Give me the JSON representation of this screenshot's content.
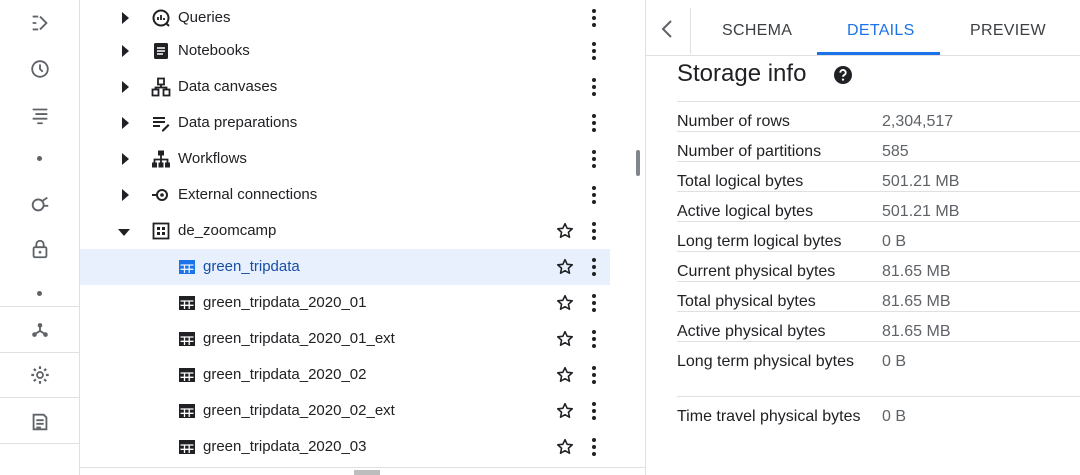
{
  "rail": {
    "icons": [
      "transfer-icon",
      "history-icon",
      "list-icon",
      "analytics-icon",
      "lock-icon",
      "hub-icon",
      "settings-icon",
      "notes-icon"
    ]
  },
  "explorer": {
    "rows": [
      {
        "label": "Queries",
        "icon": "queries-icon",
        "expander": "collapsed",
        "star": false
      },
      {
        "label": "Notebooks",
        "icon": "notebook-icon",
        "expander": "collapsed",
        "star": false
      },
      {
        "label": "Data canvases",
        "icon": "canvas-icon",
        "expander": "collapsed",
        "star": false
      },
      {
        "label": "Data preparations",
        "icon": "data-prep-icon",
        "expander": "collapsed",
        "star": false
      },
      {
        "label": "Workflows",
        "icon": "workflow-icon",
        "expander": "collapsed",
        "star": false
      },
      {
        "label": "External connections",
        "icon": "connection-icon",
        "expander": "collapsed",
        "star": false
      },
      {
        "label": "de_zoomcamp",
        "icon": "dataset-icon",
        "expander": "expanded",
        "star": true
      },
      {
        "label": "green_tripdata",
        "icon": "table-icon",
        "expander": "none",
        "star": true,
        "selected": true
      },
      {
        "label": "green_tripdata_2020_01",
        "icon": "table-icon",
        "expander": "none",
        "star": true
      },
      {
        "label": "green_tripdata_2020_01_ext",
        "icon": "table-icon",
        "expander": "none",
        "star": true
      },
      {
        "label": "green_tripdata_2020_02",
        "icon": "table-icon",
        "expander": "none",
        "star": true
      },
      {
        "label": "green_tripdata_2020_02_ext",
        "icon": "table-icon",
        "expander": "none",
        "star": true
      },
      {
        "label": "green_tripdata_2020_03",
        "icon": "table-icon",
        "expander": "none",
        "star": true
      }
    ]
  },
  "panel": {
    "tabs": [
      {
        "label": "SCHEMA",
        "active": false
      },
      {
        "label": "DETAILS",
        "active": true
      },
      {
        "label": "PREVIEW",
        "active": false
      }
    ],
    "title": "Storage info",
    "rows": [
      {
        "key": "Number of rows",
        "value": "2,304,517"
      },
      {
        "key": "Number of partitions",
        "value": "585"
      },
      {
        "key": "Total logical bytes",
        "value": "501.21 MB"
      },
      {
        "key": "Active logical bytes",
        "value": "501.21 MB"
      },
      {
        "key": "Long term logical bytes",
        "value": "0 B"
      },
      {
        "key": "Current physical bytes",
        "value": "81.65 MB"
      },
      {
        "key": "Total physical bytes",
        "value": "81.65 MB"
      },
      {
        "key": "Active physical bytes",
        "value": "81.65 MB"
      },
      {
        "key": "Long term physical bytes",
        "value": "0 B"
      },
      {
        "key": "Time travel physical bytes",
        "value": "0 B"
      }
    ]
  },
  "colors": {
    "accent": "#1a73e8",
    "selected_bg": "#e8f0fe",
    "selected_text": "#174ea6"
  }
}
